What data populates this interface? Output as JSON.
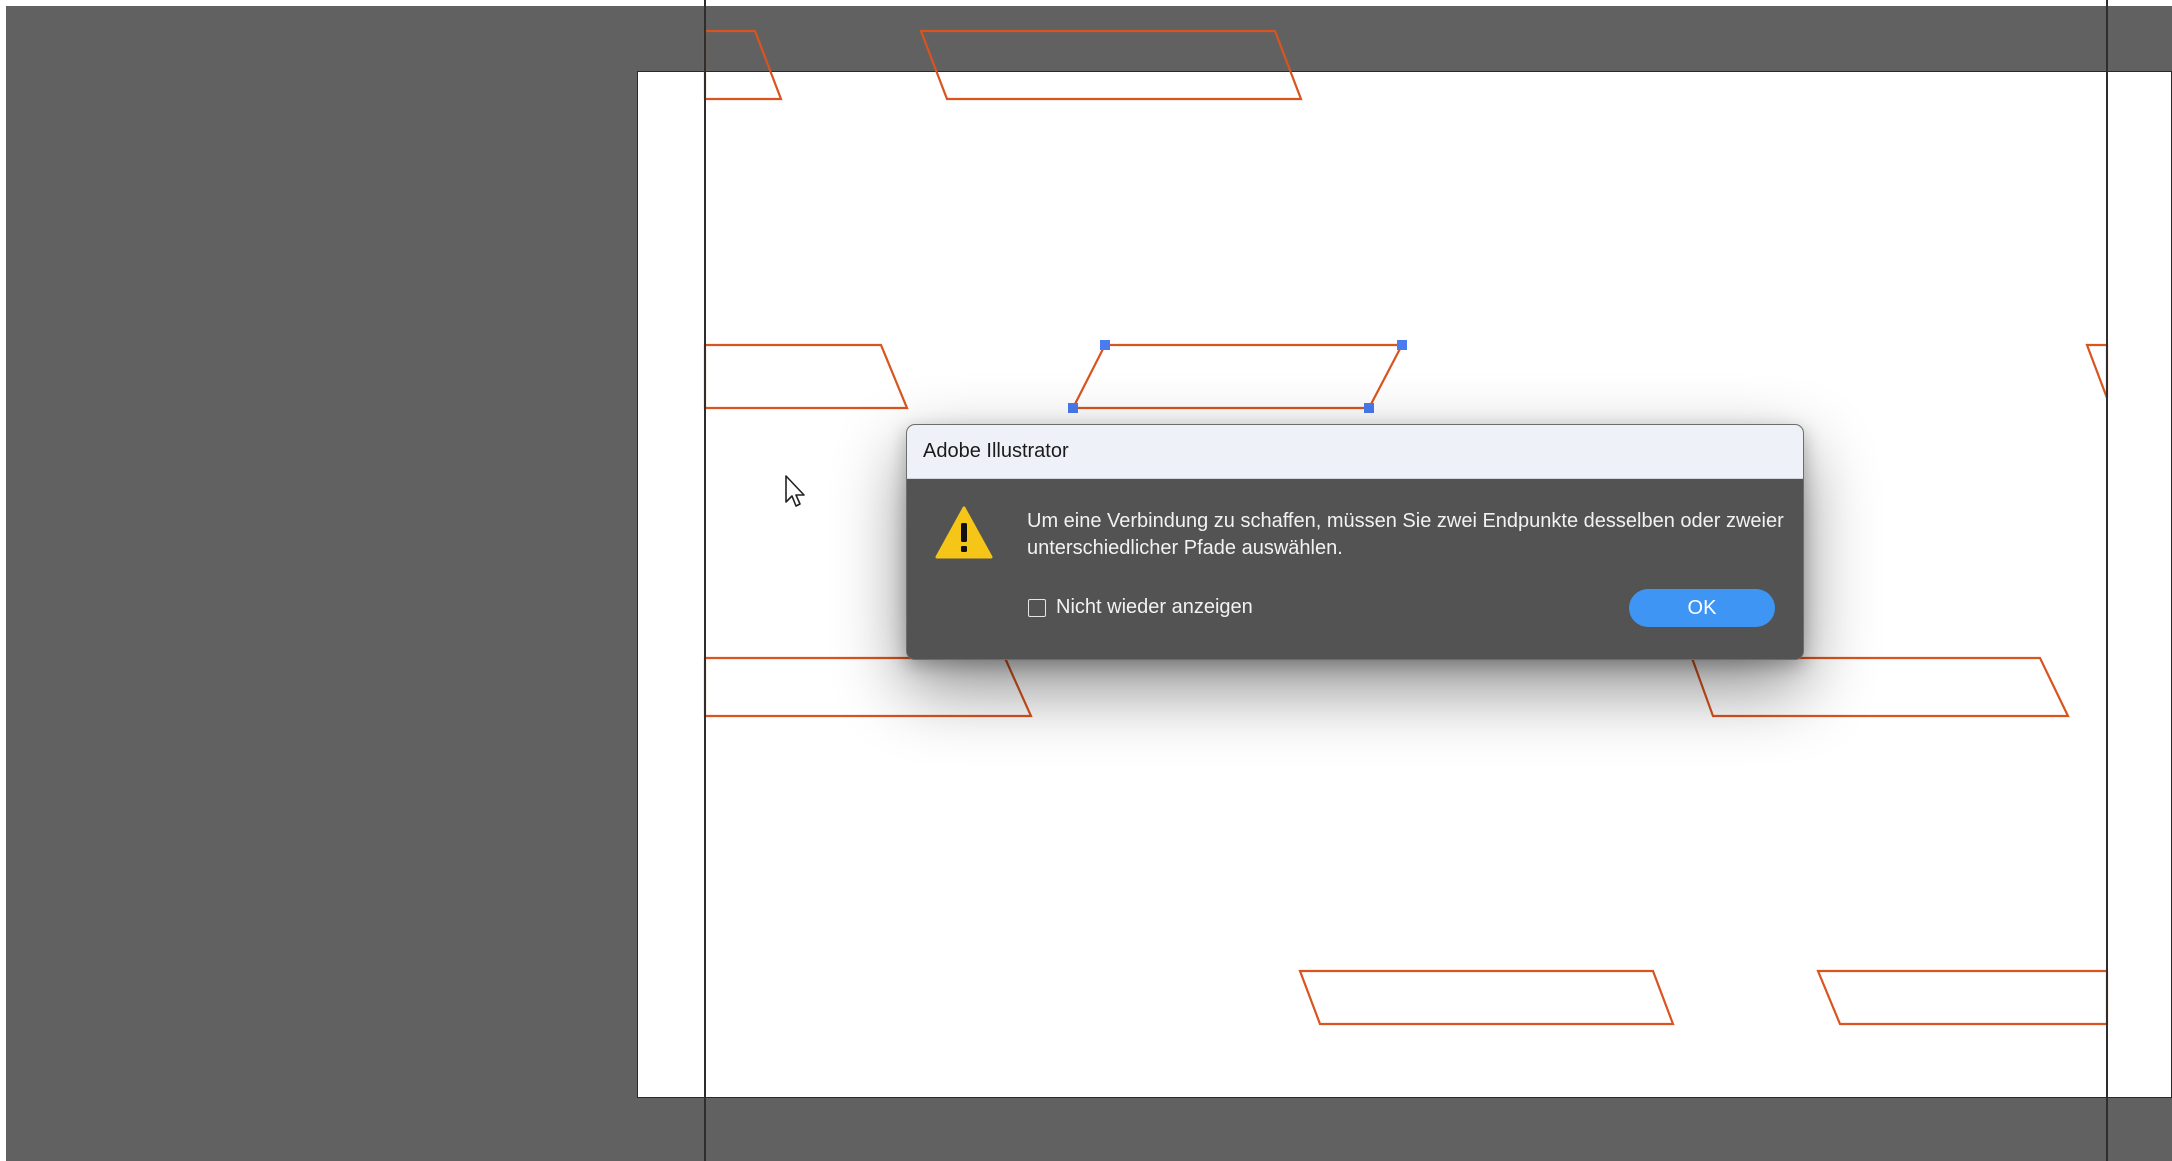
{
  "dialog": {
    "title": "Adobe Illustrator",
    "message": "Um eine Verbindung zu schaffen, müssen Sie zwei Endpunkte desselben oder zweier unterschiedlicher Pfade auswählen.",
    "checkbox_label": "Nicht wieder anzeigen",
    "checkbox_checked": false,
    "ok_label": "OK"
  },
  "canvas": {
    "pasteboard_color": "#616161",
    "artboard_color": "#ffffff",
    "path_stroke_color": "#d9541f",
    "selection_anchor_color": "#4a7cf0"
  }
}
